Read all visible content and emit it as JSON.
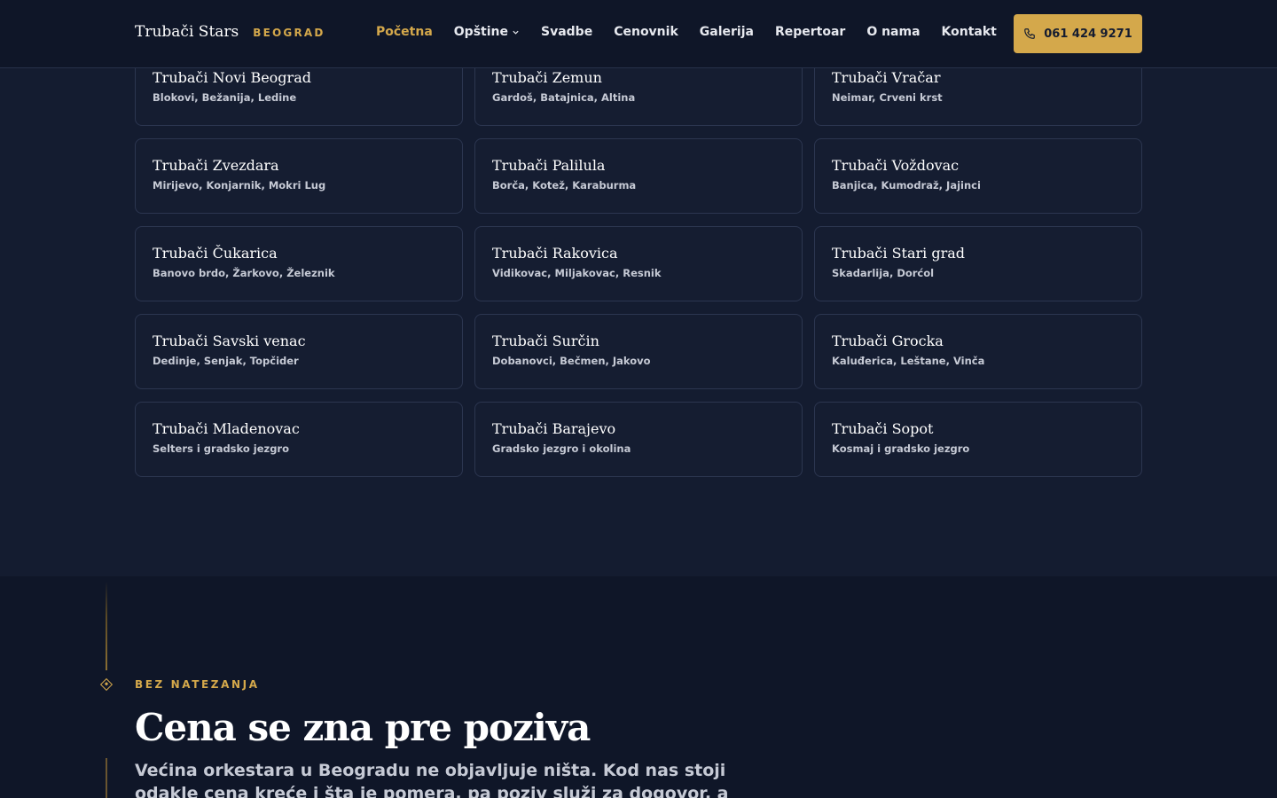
{
  "header": {
    "brand": "Trubači Stars",
    "city": "BEOGRAD",
    "nav": [
      {
        "label": "Početna",
        "active": true
      },
      {
        "label": "Opštine",
        "dropdown": true
      },
      {
        "label": "Svadbe"
      },
      {
        "label": "Cenovnik"
      },
      {
        "label": "Galerija"
      },
      {
        "label": "Repertoar"
      },
      {
        "label": "O nama"
      },
      {
        "label": "Kontakt"
      }
    ],
    "phone": "061 424 9271",
    "phone_icon": "phone-icon"
  },
  "municipalities": [
    {
      "title": "Trubači Novi Beograd",
      "areas": "Blokovi, Bežanija, Ledine"
    },
    {
      "title": "Trubači Zemun",
      "areas": "Gardoš, Batajnica, Altina"
    },
    {
      "title": "Trubači Vračar",
      "areas": "Neimar, Crveni krst"
    },
    {
      "title": "Trubači Zvezdara",
      "areas": "Mirijevo, Konjarnik, Mokri Lug"
    },
    {
      "title": "Trubači Palilula",
      "areas": "Borča, Kotež, Karaburma"
    },
    {
      "title": "Trubači Voždovac",
      "areas": "Banjica, Kumodraž, Jajinci"
    },
    {
      "title": "Trubači Čukarica",
      "areas": "Banovo brdo, Žarkovo, Železnik"
    },
    {
      "title": "Trubači Rakovica",
      "areas": "Vidikovac, Miljakovac, Resnik"
    },
    {
      "title": "Trubači Stari grad",
      "areas": "Skadarlija, Dorćol"
    },
    {
      "title": "Trubači Savski venac",
      "areas": "Dedinje, Senjak, Topčider"
    },
    {
      "title": "Trubači Surčin",
      "areas": "Dobanovci, Bečmen, Jakovo"
    },
    {
      "title": "Trubači Grocka",
      "areas": "Kaluđerica, Leštane, Vinča"
    },
    {
      "title": "Trubači Mladenovac",
      "areas": "Selters i gradsko jezgro"
    },
    {
      "title": "Trubači Barajevo",
      "areas": "Gradsko jezgro i okolina"
    },
    {
      "title": "Trubači Sopot",
      "areas": "Kosmaj i gradsko jezgro"
    }
  ],
  "pricing": {
    "eyebrow": "BEZ NATEZANJA",
    "title": "Cena se zna pre poziva",
    "text": "Većina orkestara u Beogradu ne objavljuje ništa. Kod nas stoji odakle cena kreće i šta je pomera, pa poziv služi za dogovor, a ne za"
  },
  "colors": {
    "accent": "#d4a84b",
    "background": "#141c30",
    "header": "#0f1628"
  }
}
